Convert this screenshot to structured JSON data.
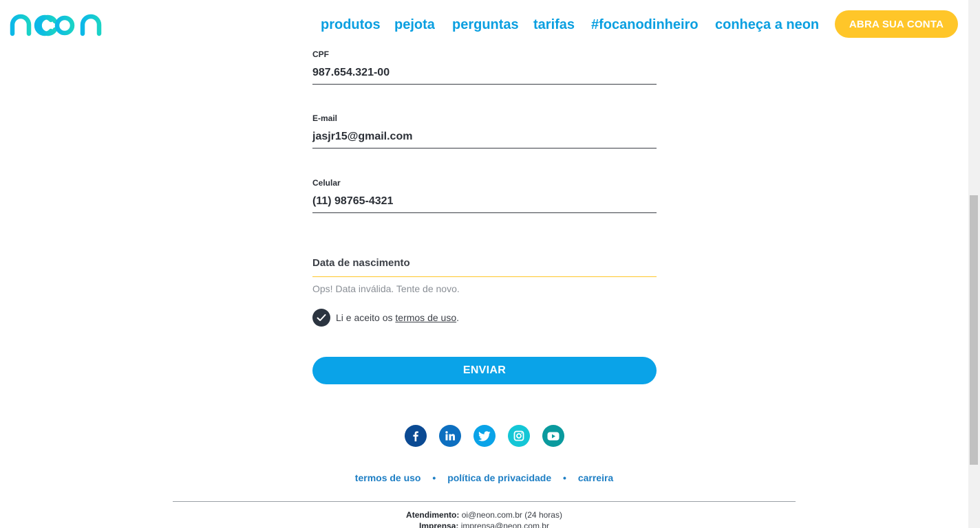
{
  "header": {
    "logo_text": "neon",
    "nav": [
      "produtos",
      "pejota",
      "perguntas",
      "tarifas",
      "#focanodinheiro",
      "conheça a neon"
    ],
    "cta": "ABRA SUA CONTA"
  },
  "form": {
    "cpf": {
      "label": "CPF",
      "value": "987.654.321-00"
    },
    "email": {
      "label": "E-mail",
      "value": "jasjr15@gmail.com"
    },
    "phone": {
      "label": "Celular",
      "value": "(11) 98765-4321"
    },
    "birthdate": {
      "placeholder": "Data de nascimento",
      "error": "Ops! Data inválida. Tente de novo."
    },
    "terms": {
      "prefix": "Li e aceito os ",
      "link": "termos de uso",
      "suffix": ".",
      "checked": true
    },
    "submit": "ENVIAR"
  },
  "footer": {
    "social": [
      "facebook-icon",
      "linkedin-icon",
      "twitter-icon",
      "instagram-icon",
      "youtube-icon"
    ],
    "links": [
      "termos de uso",
      "política de privacidade",
      "carreira"
    ],
    "separator": "•",
    "contact": [
      {
        "label": "Atendimento:",
        "value": "oi@neon.com.br (24 horas)"
      },
      {
        "label": "Imprensa:",
        "value": "imprensa@neon.com.br"
      }
    ]
  },
  "colors": {
    "brand_blue": "#0aa3e8",
    "nav_blue": "#0a9fe0",
    "cta_yellow": "#ffc629",
    "logo_gradient_start": "#0cb8e8",
    "logo_gradient_end": "#1ad3c6"
  }
}
